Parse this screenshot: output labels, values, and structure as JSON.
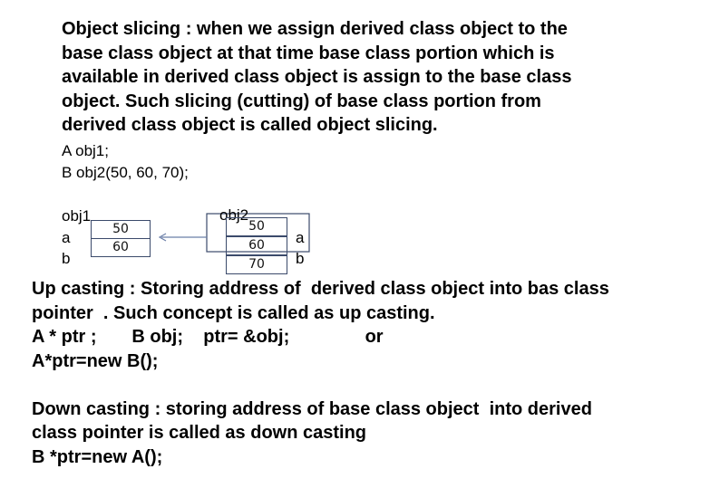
{
  "slicing": {
    "lines": [
      "Object slicing : when we assign derived class object to the",
      "base class object at that time base class portion which is",
      "available in derived class object is assign to the base class",
      "object. Such slicing (cutting) of base class portion from",
      "derived class object is called object slicing."
    ]
  },
  "code": {
    "line1": "A obj1;",
    "line2": "B obj2(50, 60, 70);"
  },
  "diagram": {
    "obj1_label": "obj1",
    "obj2_label": "obj2",
    "left_a": "a",
    "left_b": "b",
    "right_a": "a",
    "right_b": "b",
    "obj1_cells": [
      "50",
      "60"
    ],
    "obj2_cells": [
      "50",
      "60",
      "70"
    ]
  },
  "casting": {
    "upcast_line1": "Up casting : Storing address of  derived class object into bas class",
    "upcast_line2": "pointer  . Such concept is called as up casting.",
    "upcast_code1": "A * ptr ;       B obj;    ptr= &obj;               or",
    "upcast_code2": "A*ptr=new B();",
    "downcast_line1": "Down casting : storing address of base class object  into derived",
    "downcast_line2": "class pointer is called as down casting",
    "downcast_code": "B *ptr=new A();"
  }
}
